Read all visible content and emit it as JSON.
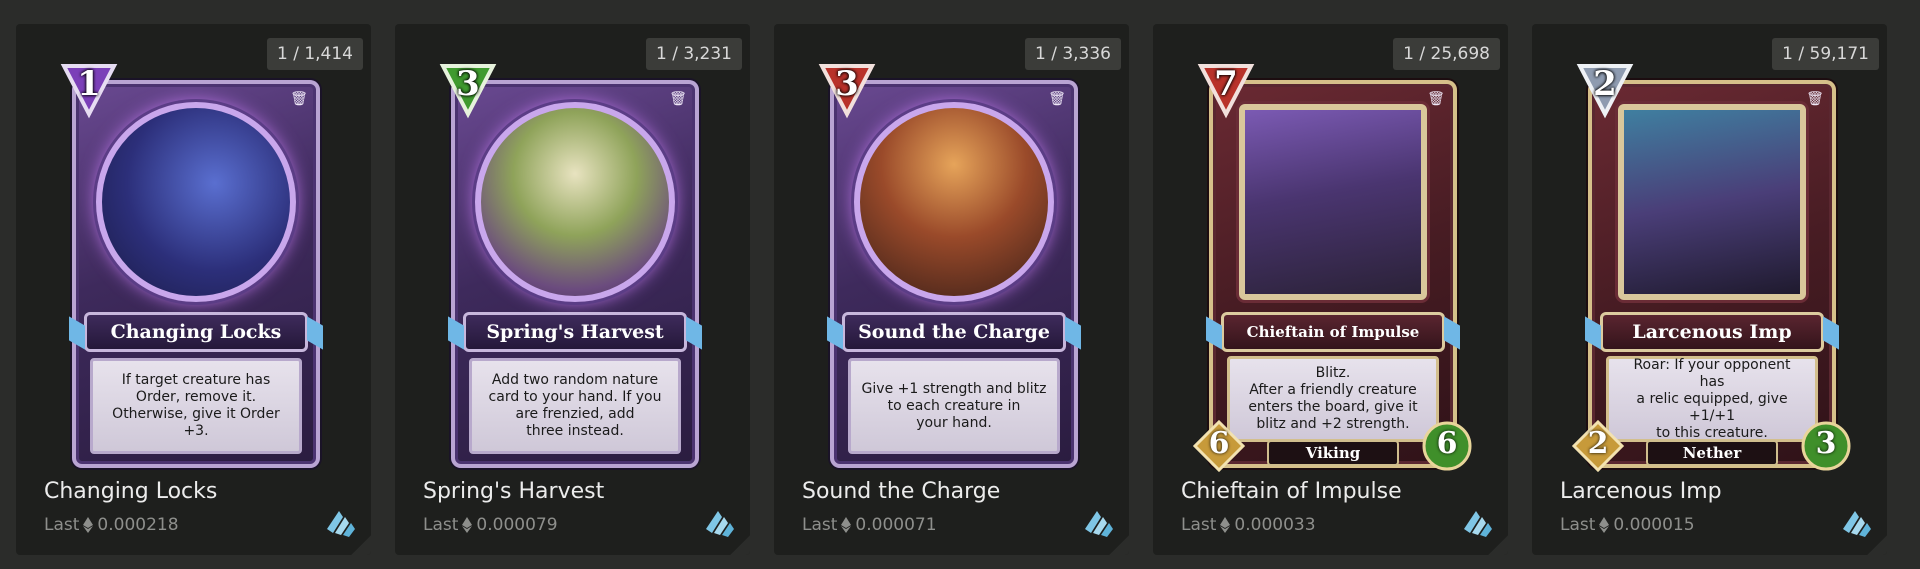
{
  "cards": [
    {
      "supply": "1 / 1,414",
      "cost": "1",
      "gem_color": "#7b3fb8",
      "title": "Changing Locks",
      "text": "If target creature has\nOrder, remove it.\nOtherwise, give it Order +3.",
      "name": "Changing Locks",
      "price_label": "Last",
      "price": "0.000218",
      "type": "spell"
    },
    {
      "supply": "1 / 3,231",
      "cost": "3",
      "gem_color": "#3f9a2f",
      "title": "Spring's Harvest",
      "text": "Add two random nature\ncard to your hand. If you\nare frenzied, add\nthree instead.",
      "name": "Spring's Harvest",
      "price_label": "Last",
      "price": "0.000079",
      "type": "spell"
    },
    {
      "supply": "1 / 3,336",
      "cost": "3",
      "gem_color": "#b8322a",
      "title": "Sound the Charge",
      "text": "Give +1 strength and blitz\nto each creature in\nyour hand.",
      "name": "Sound the Charge",
      "price_label": "Last",
      "price": "0.000071",
      "type": "spell"
    },
    {
      "supply": "1 / 25,698",
      "cost": "7",
      "gem_color": "#b8322a",
      "title": "Chieftain of Impulse",
      "text": "Blitz.\nAfter a friendly creature\nenters the board, give it\nblitz and +2 strength.",
      "attack": "6",
      "health": "6",
      "tribe": "Viking",
      "name": "Chieftain of Impulse",
      "price_label": "Last",
      "price": "0.000033",
      "type": "creature"
    },
    {
      "supply": "1 / 59,171",
      "cost": "2",
      "gem_color": "#8e9bb0",
      "title": "Larcenous Imp",
      "text": "Roar: If your opponent has\na relic equipped, give +1/+1\nto this creature.",
      "attack": "2",
      "health": "3",
      "tribe": "Nether",
      "name": "Larcenous Imp",
      "price_label": "Last",
      "price": "0.000015",
      "type": "creature"
    }
  ],
  "icons": {
    "trash": "trash-icon",
    "currency": "eth-icon",
    "market": "immutable-market-icon"
  },
  "colors": {
    "background": "#2b2c2a",
    "tile": "#1e1f1d",
    "price_text": "#8e8f8c",
    "market_icon": "#7fc6e6"
  }
}
